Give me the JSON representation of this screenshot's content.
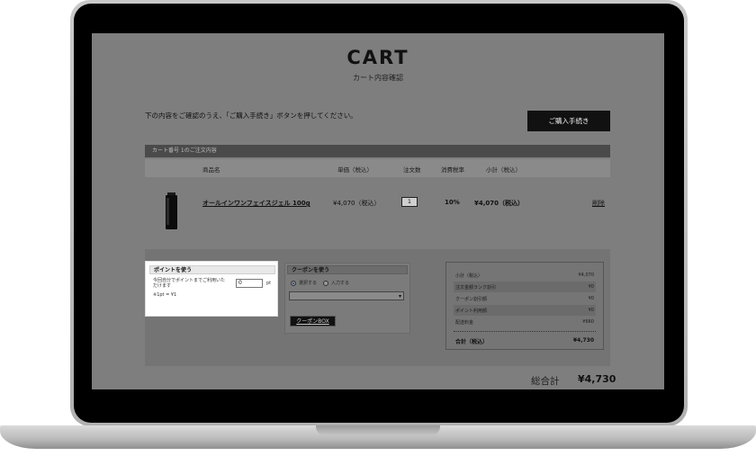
{
  "page": {
    "title": "CART",
    "subtitle": "カート内容確認",
    "instruction": "下の内容をご確認のうえ、「ご購入手続き」ボタンを押してください。",
    "checkout_button": "ご購入手続き"
  },
  "cart": {
    "bar_label": "カート番号 1のご注文内容",
    "headers": {
      "product": "商品名",
      "unit_price": "単価（税込）",
      "quantity": "注文数",
      "tax_rate": "消費税率",
      "subtotal": "小計（税込）"
    },
    "item": {
      "name": "オールインワンフェイスジェル 100g",
      "unit_price": "¥4,070（税込）",
      "quantity": "1",
      "tax_rate": "10%",
      "subtotal": "¥4,070（税込）",
      "delete_label": "削除",
      "image_icon": "bottle-icon"
    }
  },
  "points": {
    "heading": "ポイントを使う",
    "note": "今回自分でポイントまでご利用いただけます",
    "rate": "※1pt = ¥1",
    "input_value": "0",
    "unit": "pt"
  },
  "coupon": {
    "heading": "クーポンを使う",
    "option_select": "選択する",
    "option_input": "入力する",
    "selected_option": "選択する",
    "button_label": "クーポンBOX"
  },
  "summary": {
    "rows": [
      {
        "label": "小計（税込）",
        "value": "¥4,070"
      },
      {
        "label": "注文金額ランク割引",
        "value": "¥0"
      },
      {
        "label": "クーポン割引額",
        "value": "¥0"
      },
      {
        "label": "ポイント利用額",
        "value": "¥0"
      },
      {
        "label": "配送料金",
        "value": "¥660"
      }
    ],
    "total_label": "合計（税込）",
    "total_value": "¥4,730"
  },
  "grand_total": {
    "label": "総合計",
    "value": "¥4,730"
  },
  "colors": {
    "overlay": "#7e7e7e",
    "button_bg": "#111111",
    "highlight_box": "#ffffff"
  }
}
